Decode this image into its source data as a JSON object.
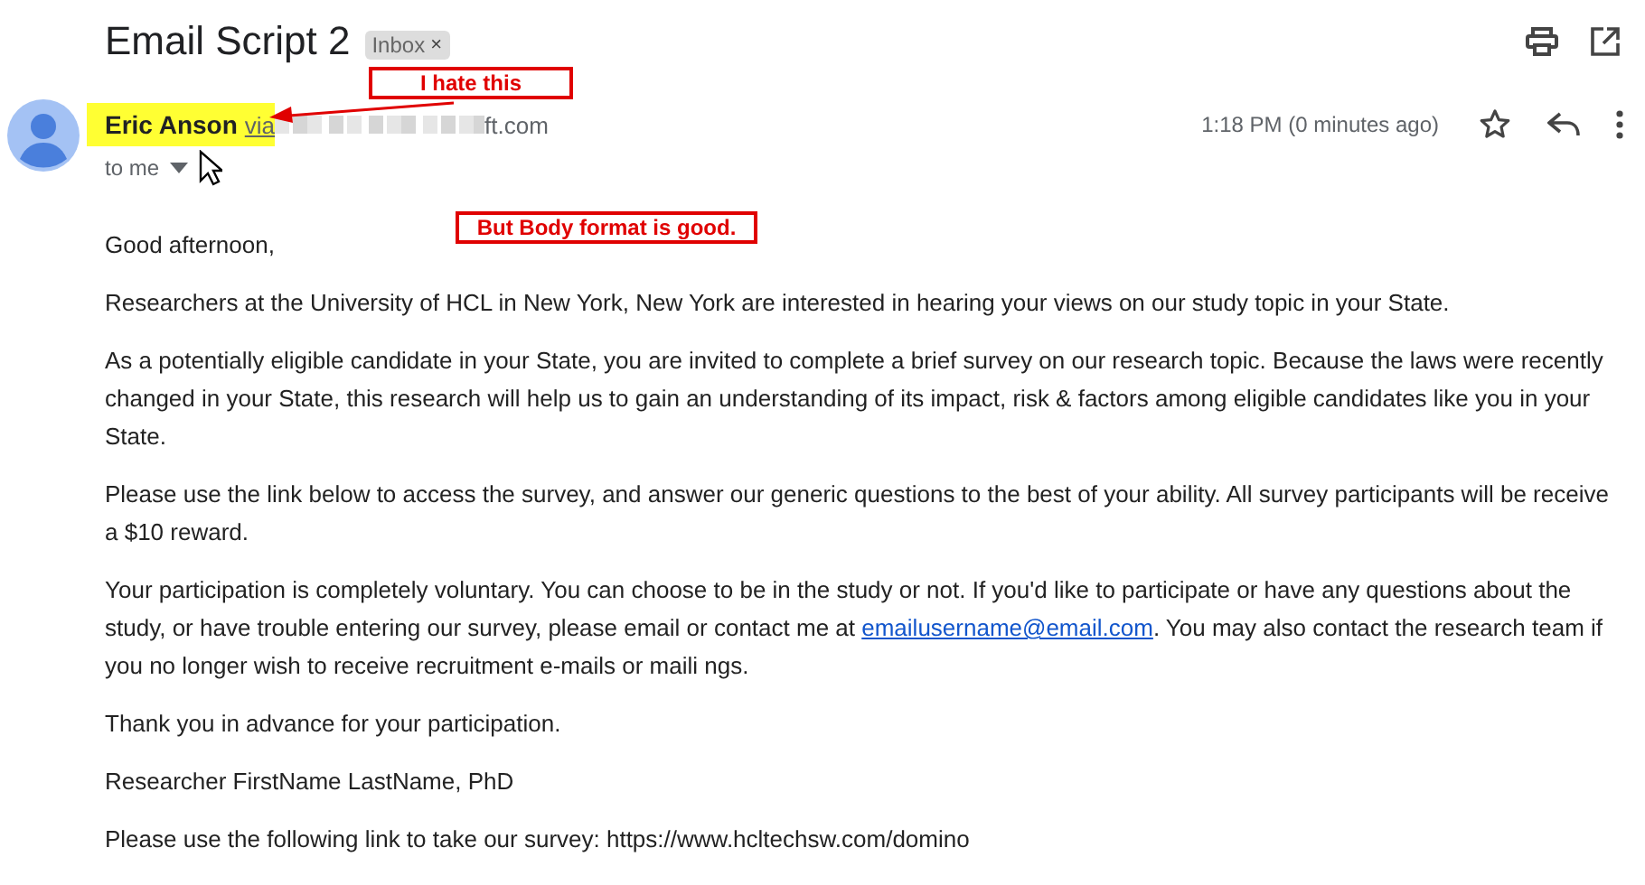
{
  "email": {
    "subject": "Email Script 2",
    "label": {
      "text": "Inbox",
      "remove": "×"
    },
    "sender": {
      "name": "Eric Anson",
      "via": "via",
      "address_tail": "ft.com",
      "highlighted": true
    },
    "recipient": "to me",
    "time": "1:18 PM (0 minutes ago)",
    "starred": false,
    "body": [
      {
        "segments": [
          {
            "kind": "text",
            "text": "Good afternoon,"
          }
        ]
      },
      {
        "segments": [
          {
            "kind": "text",
            "text": "Researchers at the University of HCL in New York, New York are interested in hearing your views on our study topic in your State."
          }
        ]
      },
      {
        "segments": [
          {
            "kind": "text",
            "text": "As a potentially eligible candidate in your State, you are invited to complete a brief survey on our research topic. Because the laws were recently changed in your State, this research will help us to gain an understanding of its impact, risk & factors among eligible candidates like you in your State."
          }
        ]
      },
      {
        "segments": [
          {
            "kind": "text",
            "text": "Please use the link below to access the survey, and answer our generic questions to the best of your ability. All survey participants will be receive a $10 reward."
          }
        ]
      },
      {
        "segments": [
          {
            "kind": "text",
            "text": "Your participation is completely voluntary. You can choose to be in the study or not. If you'd like to participate or have any questions about the study, or have trouble entering our survey, please email or contact me at "
          },
          {
            "kind": "link",
            "text": "emailusername@email.com"
          },
          {
            "kind": "text",
            "text": ". You may also contact the research team if you no longer wish to receive recruitment e-mails or maili ngs."
          }
        ]
      },
      {
        "segments": [
          {
            "kind": "text",
            "text": "Thank you in advance for your participation."
          }
        ]
      },
      {
        "segments": [
          {
            "kind": "text",
            "text": "Researcher FirstName LastName, PhD"
          }
        ]
      },
      {
        "segments": [
          {
            "kind": "text",
            "text": "Please use the following link to take our survey: https://www.hcltechsw.com/domino"
          }
        ]
      }
    ]
  },
  "annotations": [
    {
      "text": "I hate this",
      "arrow": true
    },
    {
      "text": "But Body format is good.",
      "arrow": false
    }
  ]
}
